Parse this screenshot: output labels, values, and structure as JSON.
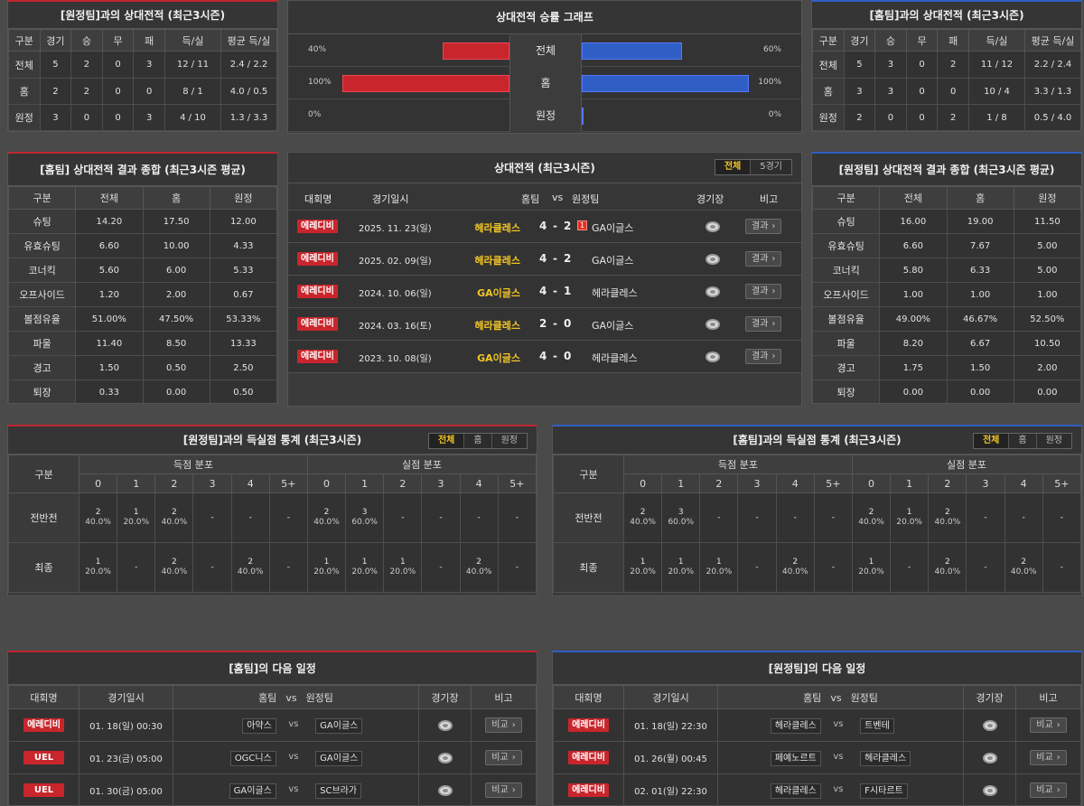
{
  "colors": {
    "home_accent": "#c8262c",
    "away_accent": "#2f5fc4",
    "highlight": "#f3c623"
  },
  "left_h2h": {
    "title": "[원정팀]과의 상대전적 (최근3시즌)",
    "headers": [
      "구분",
      "경기",
      "승",
      "무",
      "패",
      "득/실",
      "평균 득/실"
    ],
    "rows": [
      [
        "전체",
        "5",
        "2",
        "0",
        "3",
        "12 / 11",
        "2.4 / 2.2"
      ],
      [
        "홈",
        "2",
        "2",
        "0",
        "0",
        "8 / 1",
        "4.0 / 0.5"
      ],
      [
        "원정",
        "3",
        "0",
        "0",
        "3",
        "4 / 10",
        "1.3 / 3.3"
      ]
    ]
  },
  "graph": {
    "title": "상대전적 승률 그래프",
    "rows": [
      {
        "label": "전체",
        "left_pct": "40%",
        "right_pct": "60%",
        "left_val": 40,
        "right_val": 60
      },
      {
        "label": "홈",
        "left_pct": "100%",
        "right_pct": "100%",
        "left_val": 100,
        "right_val": 100
      },
      {
        "label": "원정",
        "left_pct": "0%",
        "right_pct": "0%",
        "left_val": 0,
        "right_val": 0
      }
    ]
  },
  "right_h2h": {
    "title": "[홈팀]과의 상대전적 (최근3시즌)",
    "headers": [
      "구분",
      "경기",
      "승",
      "무",
      "패",
      "득/실",
      "평균 득/실"
    ],
    "rows": [
      [
        "전체",
        "5",
        "3",
        "0",
        "2",
        "11 / 12",
        "2.2 / 2.4"
      ],
      [
        "홈",
        "3",
        "3",
        "0",
        "0",
        "10 / 4",
        "3.3 / 1.3"
      ],
      [
        "원정",
        "2",
        "0",
        "0",
        "2",
        "1 / 8",
        "0.5 / 4.0"
      ]
    ]
  },
  "left_summary": {
    "title": "[홈팀] 상대전적 결과 종합 (최근3시즌 평균)",
    "headers": [
      "구분",
      "전체",
      "홈",
      "원정"
    ],
    "rows": [
      [
        "슈팅",
        "14.20",
        "17.50",
        "12.00"
      ],
      [
        "유효슈팅",
        "6.60",
        "10.00",
        "4.33"
      ],
      [
        "코너킥",
        "5.60",
        "6.00",
        "5.33"
      ],
      [
        "오프사이드",
        "1.20",
        "2.00",
        "0.67"
      ],
      [
        "볼점유율",
        "51.00%",
        "47.50%",
        "53.33%"
      ],
      [
        "파울",
        "11.40",
        "8.50",
        "13.33"
      ],
      [
        "경고",
        "1.50",
        "0.50",
        "2.50"
      ],
      [
        "퇴장",
        "0.33",
        "0.00",
        "0.50"
      ]
    ]
  },
  "right_summary": {
    "title": "[원정팀] 상대전적 결과 종합 (최근3시즌 평균)",
    "headers": [
      "구분",
      "전체",
      "홈",
      "원정"
    ],
    "rows": [
      [
        "슈팅",
        "16.00",
        "19.00",
        "11.50"
      ],
      [
        "유효슈팅",
        "6.60",
        "7.67",
        "5.00"
      ],
      [
        "코너킥",
        "5.80",
        "6.33",
        "5.00"
      ],
      [
        "오프사이드",
        "1.00",
        "1.00",
        "1.00"
      ],
      [
        "볼점유율",
        "49.00%",
        "46.67%",
        "52.50%"
      ],
      [
        "파울",
        "8.20",
        "6.67",
        "10.50"
      ],
      [
        "경고",
        "1.75",
        "1.50",
        "2.00"
      ],
      [
        "퇴장",
        "0.00",
        "0.00",
        "0.00"
      ]
    ]
  },
  "matches": {
    "title": "상대전적 (최근3시즌)",
    "tabs": [
      "전체",
      "5경기"
    ],
    "headers": {
      "league": "대회명",
      "date": "경기일시",
      "home": "홈팀",
      "vs": "vs",
      "away": "원정팀",
      "stadium": "경기장",
      "note": "비고"
    },
    "rows": [
      {
        "league": "에레디비",
        "date": "2025. 11. 23(일)",
        "home": "헤라클레스",
        "hs": "4",
        "sep": "-",
        "as": "2",
        "card": "1",
        "away": "GA이글스",
        "btn": "결과"
      },
      {
        "league": "에레디비",
        "date": "2025. 02. 09(일)",
        "home": "헤라클레스",
        "hs": "4",
        "sep": "-",
        "as": "2",
        "card": "",
        "away": "GA이글스",
        "btn": "결과"
      },
      {
        "league": "에레디비",
        "date": "2024. 10. 06(일)",
        "home": "GA이글스",
        "hs": "4",
        "sep": "-",
        "as": "1",
        "card": "",
        "away": "헤라클레스",
        "btn": "결과"
      },
      {
        "league": "에레디비",
        "date": "2024. 03. 16(토)",
        "home": "헤라클레스",
        "hs": "2",
        "sep": "-",
        "as": "0",
        "card": "",
        "away": "GA이글스",
        "btn": "결과"
      },
      {
        "league": "에레디비",
        "date": "2023. 10. 08(일)",
        "home": "GA이글스",
        "hs": "4",
        "sep": "-",
        "as": "0",
        "card": "",
        "away": "헤라클레스",
        "btn": "결과"
      }
    ]
  },
  "left_goals": {
    "title": "[원정팀]과의 득실점 통계 (최근3시즌)",
    "tabs": [
      "전체",
      "홈",
      "원정"
    ],
    "col_label": "구분",
    "scored": "득점 분포",
    "conceded": "실점 분포",
    "buckets": [
      "0",
      "1",
      "2",
      "3",
      "4",
      "5+"
    ],
    "rows": [
      {
        "label": "전반전",
        "cells": [
          [
            "2",
            "40.0%"
          ],
          [
            "1",
            "20.0%"
          ],
          [
            "2",
            "40.0%"
          ],
          [
            "-",
            ""
          ],
          [
            "-",
            ""
          ],
          [
            "-",
            ""
          ],
          [
            "2",
            "40.0%"
          ],
          [
            "3",
            "60.0%"
          ],
          [
            "-",
            ""
          ],
          [
            "-",
            ""
          ],
          [
            "-",
            ""
          ],
          [
            "-",
            ""
          ]
        ]
      },
      {
        "label": "최종",
        "cells": [
          [
            "1",
            "20.0%"
          ],
          [
            "-",
            ""
          ],
          [
            "2",
            "40.0%"
          ],
          [
            "-",
            ""
          ],
          [
            "2",
            "40.0%"
          ],
          [
            "-",
            ""
          ],
          [
            "1",
            "20.0%"
          ],
          [
            "1",
            "20.0%"
          ],
          [
            "1",
            "20.0%"
          ],
          [
            "-",
            ""
          ],
          [
            "2",
            "40.0%"
          ],
          [
            "-",
            ""
          ]
        ]
      }
    ]
  },
  "right_goals": {
    "title": "[홈팀]과의 득실점 통계 (최근3시즌)",
    "tabs": [
      "전체",
      "홈",
      "원정"
    ],
    "col_label": "구분",
    "scored": "득점 분포",
    "conceded": "실점 분포",
    "buckets": [
      "0",
      "1",
      "2",
      "3",
      "4",
      "5+"
    ],
    "rows": [
      {
        "label": "전반전",
        "cells": [
          [
            "2",
            "40.0%"
          ],
          [
            "3",
            "60.0%"
          ],
          [
            "-",
            ""
          ],
          [
            "-",
            ""
          ],
          [
            "-",
            ""
          ],
          [
            "-",
            ""
          ],
          [
            "2",
            "40.0%"
          ],
          [
            "1",
            "20.0%"
          ],
          [
            "2",
            "40.0%"
          ],
          [
            "-",
            ""
          ],
          [
            "-",
            ""
          ],
          [
            "-",
            ""
          ]
        ]
      },
      {
        "label": "최종",
        "cells": [
          [
            "1",
            "20.0%"
          ],
          [
            "1",
            "20.0%"
          ],
          [
            "1",
            "20.0%"
          ],
          [
            "-",
            ""
          ],
          [
            "2",
            "40.0%"
          ],
          [
            "-",
            ""
          ],
          [
            "1",
            "20.0%"
          ],
          [
            "-",
            ""
          ],
          [
            "2",
            "40.0%"
          ],
          [
            "-",
            ""
          ],
          [
            "2",
            "40.0%"
          ],
          [
            "-",
            ""
          ]
        ]
      }
    ]
  },
  "left_next": {
    "title": "[홈팀]의 다음 일정",
    "headers": {
      "league": "대회명",
      "date": "경기일시",
      "home": "홈팀",
      "vs": "vs",
      "away": "원정팀",
      "stadium": "경기장",
      "note": "비고"
    },
    "rows": [
      {
        "league": "에레디비",
        "date": "01. 18(일) 00:30",
        "home": "아약스",
        "vs": "vs",
        "away": "GA이글스",
        "btn": "비교"
      },
      {
        "league": "UEL",
        "date": "01. 23(금) 05:00",
        "home": "OGC니스",
        "vs": "vs",
        "away": "GA이글스",
        "btn": "비교"
      },
      {
        "league": "UEL",
        "date": "01. 30(금) 05:00",
        "home": "GA이글스",
        "vs": "vs",
        "away": "SC브라가",
        "btn": "비교"
      }
    ]
  },
  "right_next": {
    "title": "[원정팀]의 다음 일정",
    "headers": {
      "league": "대회명",
      "date": "경기일시",
      "home": "홈팀",
      "vs": "vs",
      "away": "원정팀",
      "stadium": "경기장",
      "note": "비고"
    },
    "rows": [
      {
        "league": "에레디비",
        "date": "01. 18(일) 22:30",
        "home": "헤라클레스",
        "vs": "vs",
        "away": "트벤테",
        "btn": "비교"
      },
      {
        "league": "에레디비",
        "date": "01. 26(월) 00:45",
        "home": "페예노르트",
        "vs": "vs",
        "away": "헤라클레스",
        "btn": "비교"
      },
      {
        "league": "에레디비",
        "date": "02. 01(일) 22:30",
        "home": "헤라클레스",
        "vs": "vs",
        "away": "F시타르트",
        "btn": "비교"
      }
    ]
  }
}
